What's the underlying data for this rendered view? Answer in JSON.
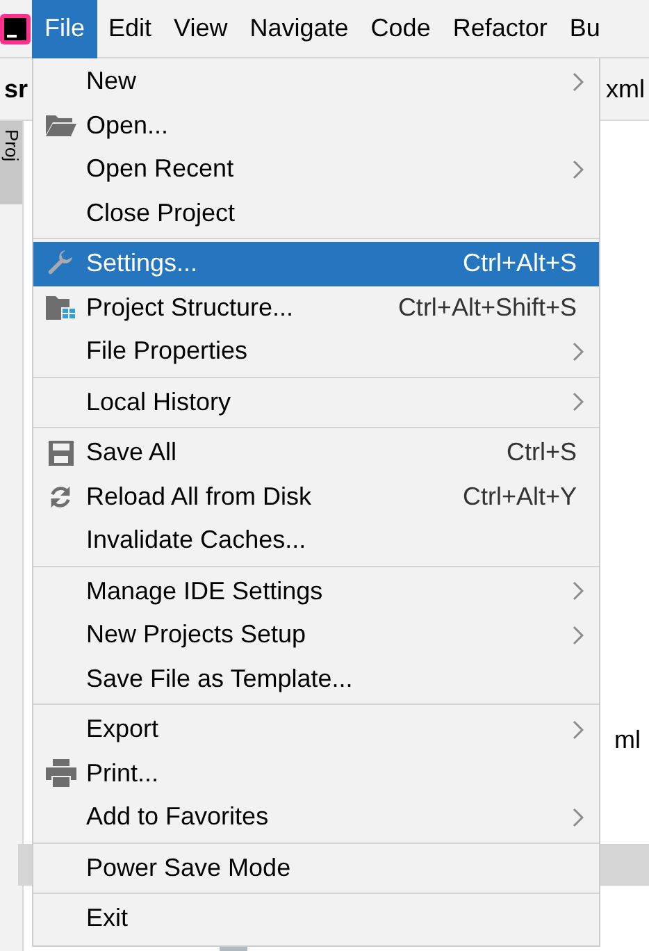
{
  "menubar": [
    {
      "label": "File",
      "selected": true
    },
    {
      "label": "Edit",
      "selected": false
    },
    {
      "label": "View",
      "selected": false
    },
    {
      "label": "Navigate",
      "selected": false
    },
    {
      "label": "Code",
      "selected": false
    },
    {
      "label": "Refactor",
      "selected": false
    },
    {
      "label": "Bu",
      "selected": false
    }
  ],
  "background": {
    "tab_left": "sr",
    "tab_right": "xml",
    "side_tab": "Proj",
    "file_right": "ml"
  },
  "menu": [
    [
      {
        "label": "New",
        "kind": "plain",
        "submenu": true,
        "selected": false
      },
      {
        "label": "Open...",
        "kind": "folder",
        "selected": false
      },
      {
        "label": "Open Recent",
        "kind": "plain",
        "submenu": true,
        "selected": false
      },
      {
        "label": "Close Project",
        "kind": "plain",
        "selected": false
      }
    ],
    [
      {
        "label": "Settings...",
        "kind": "wrench",
        "shortcut": "Ctrl+Alt+S",
        "selected": true
      },
      {
        "label": "Project Structure...",
        "kind": "structure",
        "shortcut": "Ctrl+Alt+Shift+S",
        "selected": false
      },
      {
        "label": "File Properties",
        "kind": "plain",
        "submenu": true,
        "selected": false
      }
    ],
    [
      {
        "label": "Local History",
        "kind": "plain",
        "submenu": true,
        "selected": false
      }
    ],
    [
      {
        "label": "Save All",
        "kind": "floppy",
        "shortcut": "Ctrl+S",
        "selected": false
      },
      {
        "label": "Reload All from Disk",
        "kind": "reload",
        "shortcut": "Ctrl+Alt+Y",
        "selected": false
      },
      {
        "label": "Invalidate Caches...",
        "kind": "plain",
        "selected": false
      }
    ],
    [
      {
        "label": "Manage IDE Settings",
        "kind": "plain",
        "submenu": true,
        "selected": false
      },
      {
        "label": "New Projects Setup",
        "kind": "plain",
        "submenu": true,
        "selected": false
      },
      {
        "label": "Save File as Template...",
        "kind": "plain",
        "selected": false
      }
    ],
    [
      {
        "label": "Export",
        "kind": "plain",
        "submenu": true,
        "selected": false
      },
      {
        "label": "Print...",
        "kind": "printer",
        "selected": false
      },
      {
        "label": "Add to Favorites",
        "kind": "plain",
        "submenu": true,
        "selected": false
      }
    ],
    [
      {
        "label": "Power Save Mode",
        "kind": "plain",
        "selected": false
      }
    ],
    [
      {
        "label": "Exit",
        "kind": "plain",
        "selected": false
      }
    ]
  ]
}
